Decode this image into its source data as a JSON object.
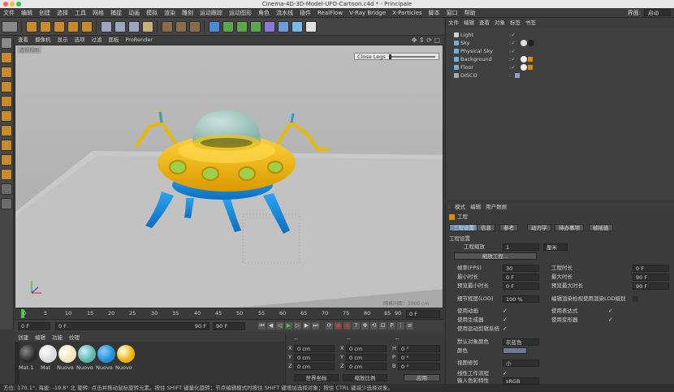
{
  "window": {
    "title": "Cinema-4D-3D-Model-UFO-Cartoon.c4d * - Principale"
  },
  "menubar": {
    "items": [
      "文件",
      "编辑",
      "创建",
      "选择",
      "工具",
      "网格",
      "捕捉",
      "动画",
      "模拟",
      "渲染",
      "雕刻",
      "运动跟踪",
      "运动图形",
      "角色",
      "流水线",
      "插件",
      "RealFlow",
      "V-Ray Bridge",
      "X-Particles",
      "脚本",
      "窗口",
      "帮助"
    ],
    "layout_label": "界面:",
    "layout_value": "启动"
  },
  "viewport": {
    "menu": [
      "查看",
      "摄像机",
      "显示",
      "选项",
      "过滤",
      "面板",
      "ProRender"
    ],
    "view_label": "透视视图",
    "slider_label": "Close Legs",
    "grid_info": "网格间距：1000 cm"
  },
  "timeline": {
    "ticks": [
      "0",
      "5",
      "10",
      "15",
      "20",
      "25",
      "30",
      "35",
      "40",
      "45",
      "50",
      "55",
      "60",
      "65",
      "70",
      "75",
      "80",
      "85",
      "90"
    ],
    "current_frame": "0 F",
    "start": "0 F",
    "end_a": "0 F",
    "end_b": "90 F",
    "end_c": "90 F"
  },
  "materials": {
    "menu": [
      "创建",
      "编辑",
      "功能",
      "纹理"
    ],
    "items": [
      {
        "label": "Mat.1",
        "color": "#2a2a2a"
      },
      {
        "label": "Mat",
        "color": "#d8d8d8"
      },
      {
        "label": "Nuovo",
        "color": "#f2e4b8"
      },
      {
        "label": "Nuovo",
        "color": "#5bb5a8"
      },
      {
        "label": "Nuovo",
        "color": "#1f8fd8"
      },
      {
        "label": "Nuovo",
        "color": "#f0b000"
      }
    ]
  },
  "coords": {
    "headers": [
      "--",
      "--",
      "--"
    ],
    "rows": [
      {
        "axis": "X",
        "v1": "0 cm",
        "axis2": "X",
        "v2": "0 cm",
        "axis3": "H",
        "v3": "0 °"
      },
      {
        "axis": "Y",
        "v1": "0 cm",
        "axis2": "Y",
        "v2": "0 cm",
        "axis3": "P",
        "v3": "0 °"
      },
      {
        "axis": "Z",
        "v1": "0 cm",
        "axis2": "Z",
        "v2": "0 cm",
        "axis3": "B",
        "v3": "0 °"
      }
    ],
    "mode_a": "世界坐标",
    "mode_b": "缩放比例",
    "apply": "应用"
  },
  "status": {
    "text": "方位: 170.1°, 海拔: -19.8° 北   旋转: 点击并拖动鼠标旋转元素。按住 SHIFT 键量化旋转；节点编辑模式时按住 SHIFT 键增加选择对象；按住 CTRL 键减少选择对象。"
  },
  "object_manager": {
    "menu": [
      "文件",
      "编辑",
      "查看",
      "对象",
      "标签",
      "书签"
    ],
    "objects": [
      "Light",
      "Sky",
      "Physical Sky",
      "Background",
      "Floor",
      "DISCO"
    ]
  },
  "attribute_manager": {
    "menu": [
      "模式",
      "编辑",
      "用户数据"
    ],
    "title": "工程",
    "tabs": [
      "工程设置",
      "信息",
      "参考",
      "动力学",
      "待办事项",
      "帧插值"
    ],
    "section": "工程设置",
    "scale_label": "工程缩放",
    "scale_value": "1",
    "scale_unit": "厘米",
    "scale_btn": "缩放工程...",
    "fps_label": "帧率(FPS)",
    "fps_value": "30",
    "min_time_label": "最小时长",
    "min_time_value": "0 F",
    "preview_min_label": "预览最小时长",
    "preview_min_value": "0 F",
    "proj_time_label": "工程时长",
    "proj_time_value": "0 F",
    "max_time_label": "最大时长",
    "max_time_value": "90 F",
    "preview_max_label": "预览最大时长",
    "preview_max_value": "90 F",
    "lod_label": "细节程度(LOD)",
    "lod_value": "100 %",
    "lod_render_label": "编辑渲染检视使用渲染LOD级别",
    "use_anim": "使用动画",
    "use_expr": "使用表达式",
    "use_gen": "使用生成器",
    "use_deform": "使用变形器",
    "use_motion": "使用运动剪辑系统",
    "default_color_label": "默认对象颜色",
    "default_color_value": "灰蓝色",
    "color_label": "颜色",
    "view_clip_label": "视图修剪",
    "view_clip_value": "小",
    "linear_label": "线性工作流程",
    "input_profile_label": "输入色彩特性",
    "input_profile_value": "sRGB"
  }
}
